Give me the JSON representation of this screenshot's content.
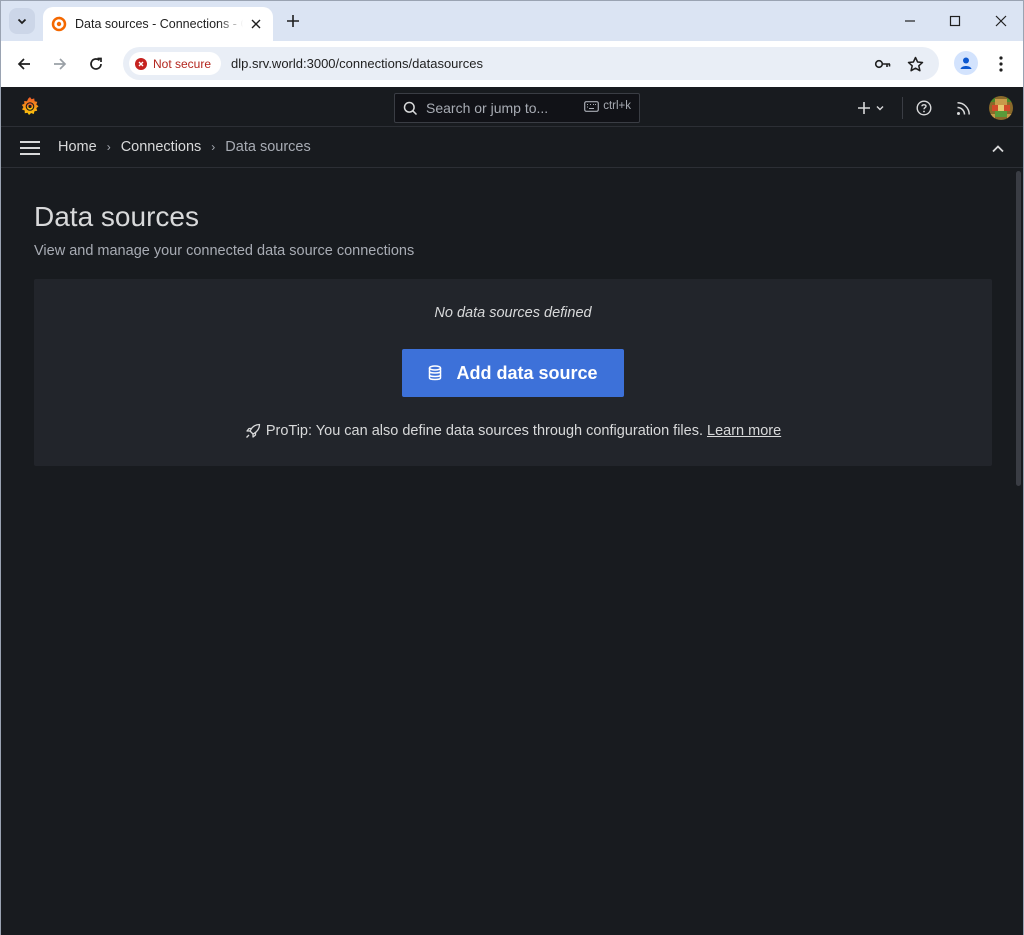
{
  "browser": {
    "tab_title": "Data sources - Connections - Grafana",
    "security_label": "Not secure",
    "url": "dlp.srv.world:3000/connections/datasources"
  },
  "grafana": {
    "search_placeholder": "Search or jump to...",
    "search_shortcut": "ctrl+k",
    "breadcrumb": {
      "home": "Home",
      "connections": "Connections",
      "current": "Data sources"
    },
    "page": {
      "title": "Data sources",
      "subtitle": "View and manage your connected data source connections"
    },
    "empty_state": {
      "message": "No data sources defined",
      "button_label": "Add data source",
      "protip": "ProTip: You can also define data sources through configuration files.",
      "learn_more": "Learn more"
    }
  },
  "colors": {
    "primary_button": "#3d71d9",
    "background": "#181b1f",
    "panel": "#22252b",
    "grafana_orange": "#f46800"
  }
}
